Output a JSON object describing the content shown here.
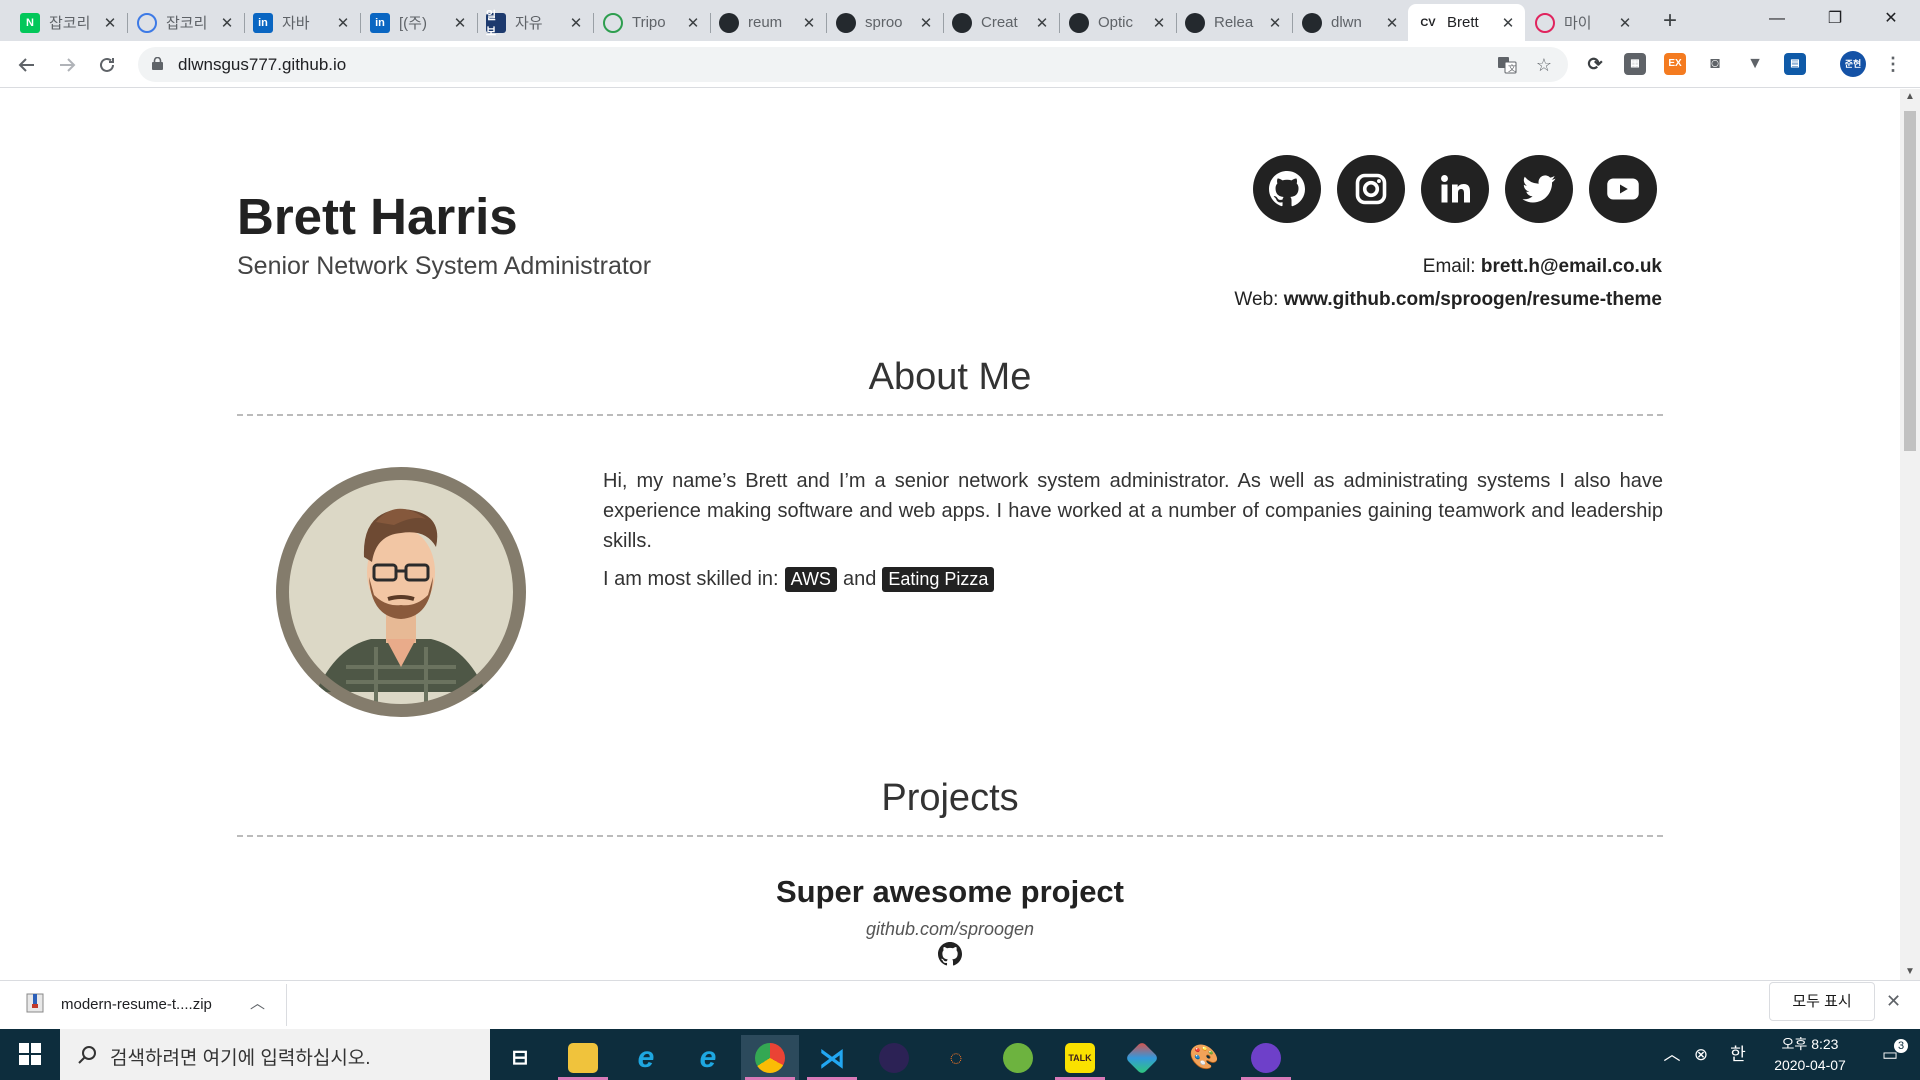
{
  "browser": {
    "tabs": [
      {
        "title": "잡코리",
        "favicon": "naver-icon",
        "fav_text": "N",
        "fav_color": "#03c75a"
      },
      {
        "title": "잡코리",
        "favicon": "chat-bubble-icon",
        "fav_text": "",
        "fav_color": "#3d7ae6"
      },
      {
        "title": "자바",
        "favicon": "linkedin-icon",
        "fav_text": "in",
        "fav_color": "#0a66c2"
      },
      {
        "title": "[(주)",
        "favicon": "linkedin-icon",
        "fav_text": "in",
        "fav_color": "#0a66c2"
      },
      {
        "title": "자유",
        "favicon": "news-icon",
        "fav_text": "일보",
        "fav_color": "#1d3a6e"
      },
      {
        "title": "Tripo",
        "favicon": "shield-icon",
        "fav_text": "",
        "fav_color": "#2e9e4f"
      },
      {
        "title": "reum",
        "favicon": "github-icon",
        "fav_text": "",
        "fav_color": "#24292e"
      },
      {
        "title": "sproo",
        "favicon": "github-icon",
        "fav_text": "",
        "fav_color": "#24292e"
      },
      {
        "title": "Creat",
        "favicon": "github-icon",
        "fav_text": "",
        "fav_color": "#24292e"
      },
      {
        "title": "Optic",
        "favicon": "github-icon",
        "fav_text": "",
        "fav_color": "#24292e"
      },
      {
        "title": "Relea",
        "favicon": "github-icon",
        "fav_text": "",
        "fav_color": "#24292e"
      },
      {
        "title": "dlwn",
        "favicon": "github-icon",
        "fav_text": "",
        "fav_color": "#24292e"
      },
      {
        "title": "Brett",
        "favicon": "cv-icon",
        "fav_text": "CV",
        "fav_color": "#ffffff",
        "active": true
      },
      {
        "title": "마이",
        "favicon": "scribble-icon",
        "fav_text": "",
        "fav_color": "#e0245e"
      }
    ],
    "new_tab": "+",
    "controls": {
      "minimize": "—",
      "maximize": "❐",
      "close": "✕"
    },
    "url": "dlwnsgus777.github.io",
    "profile_label": "준현"
  },
  "resume": {
    "name": "Brett Harris",
    "role": "Senior Network System Administrator",
    "email_label": "Email:",
    "email": "brett.h@email.co.uk",
    "web_label": "Web:",
    "web": "www.github.com/sproogen/resume-theme",
    "social": [
      "github-icon",
      "instagram-icon",
      "linkedin-icon",
      "twitter-icon",
      "youtube-icon"
    ],
    "about_title": "About Me",
    "about_text": "Hi, my name’s Brett and I’m a senior network system administrator. As well as administrating systems I also have experience making software and web apps. I have worked at a number of companies gaining teamwork and leadership skills.",
    "skills_prefix": "I am most skilled in:",
    "skill_1": "AWS",
    "skills_and": "and",
    "skill_2": "Eating Pizza",
    "projects_title": "Projects",
    "project_title": "Super awesome project",
    "project_link": "github.com/sproogen"
  },
  "download": {
    "file": "modern-resume-t....zip",
    "show_all": "모두 표시"
  },
  "taskbar": {
    "search_placeholder": "검색하려면 여기에 입력하십시오.",
    "ime": "한",
    "time": "오후 8:23",
    "date": "2020-04-07",
    "notif_count": "3"
  },
  "colors": {
    "accent_dark": "#222222",
    "taskbar": "#0d2d3d",
    "tab_strip": "#dee1e6"
  }
}
